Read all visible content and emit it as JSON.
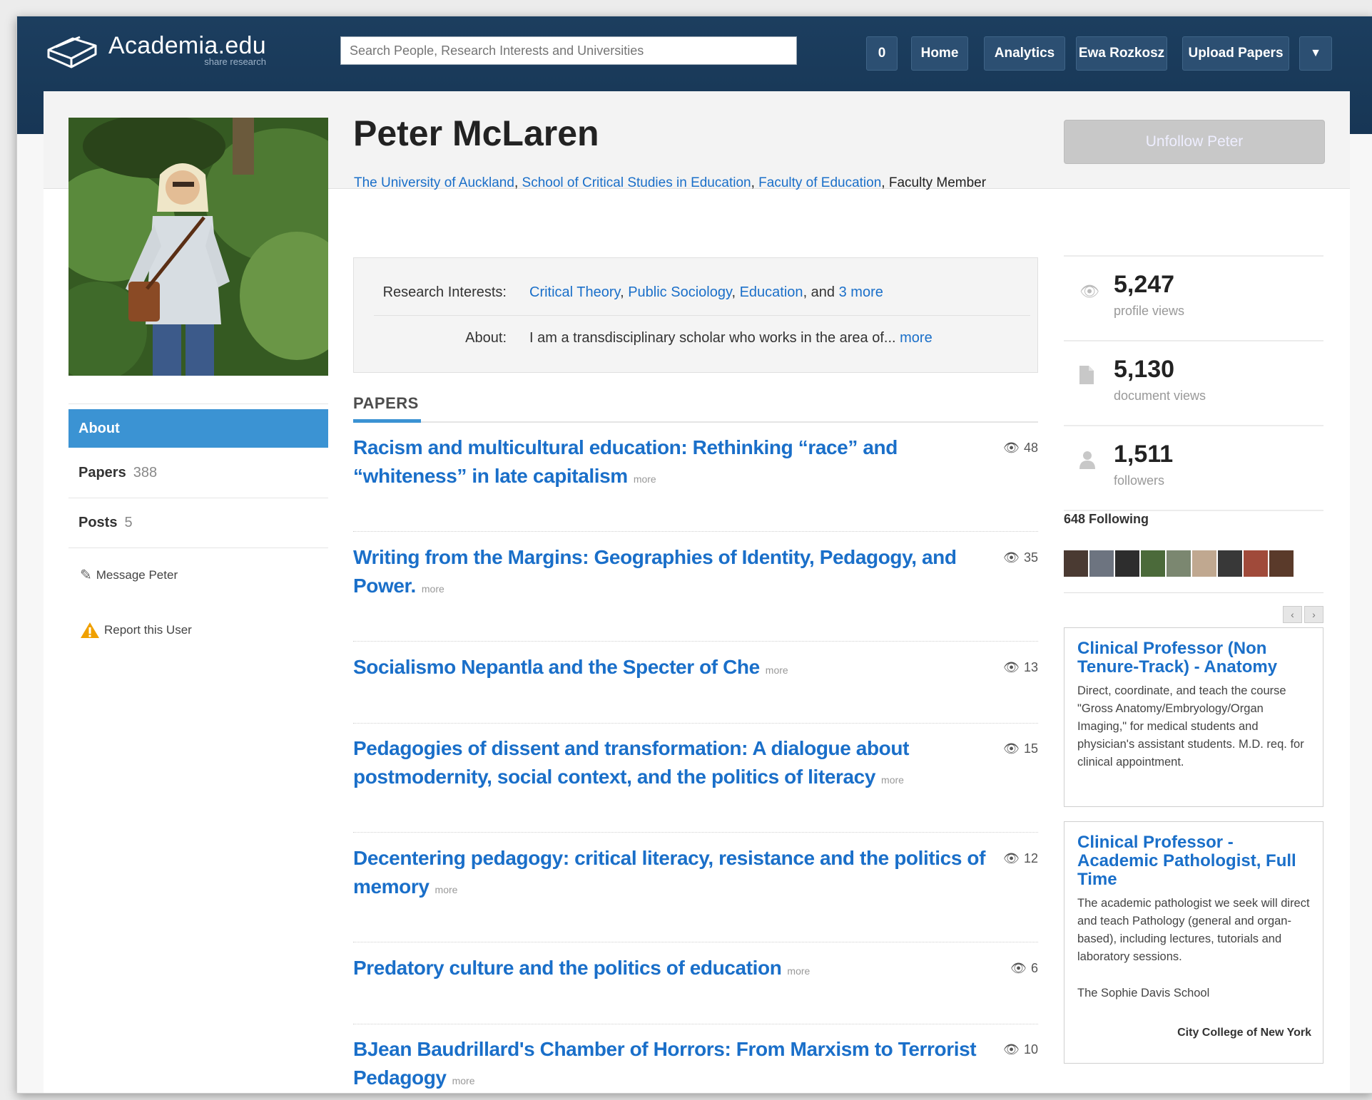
{
  "header": {
    "brand": "Academia.edu",
    "tagline": "share research",
    "search_placeholder": "Search People, Research Interests and Universities",
    "notifications_count": "0",
    "nav": [
      "Home",
      "Analytics",
      "Ewa Rozkosz",
      "Upload Papers"
    ]
  },
  "profile": {
    "name": "Peter McLaren",
    "affiliation_links": [
      "The University of Auckland",
      "School of Critical Studies in Education",
      "Faculty of Education"
    ],
    "role": ", Faculty Member",
    "unfollow_label": "Unfollow Peter"
  },
  "sidebar": {
    "active": "About",
    "items": [
      {
        "label": "Papers",
        "count": "388"
      },
      {
        "label": "Posts",
        "count": "5"
      }
    ],
    "message_label": "Message Peter",
    "report_label": "Report this User"
  },
  "info": {
    "interests_label": "Research Interests:",
    "interests": [
      "Critical Theory",
      "Public Sociology",
      "Education"
    ],
    "interests_and": ", and",
    "interests_more": "3 more",
    "about_label": "About:",
    "about_text": "I am a transdisciplinary scholar who works in the area of...",
    "about_more": "more"
  },
  "papers": {
    "heading": "PAPERS",
    "more_label": "more",
    "items": [
      {
        "title": "Racism and multicultural education: Rethinking “race” and “whiteness” in late capitalism",
        "views": "48"
      },
      {
        "title": "Writing from the Margins: Geographies of Identity, Pedagogy, and Power.",
        "views": "35"
      },
      {
        "title": "Socialismo Nepantla and the Specter of Che",
        "views": "13"
      },
      {
        "title": "Pedagogies of dissent and transformation: A dialogue about postmodernity, social context, and the politics of literacy",
        "views": "15"
      },
      {
        "title": "Decentering pedagogy: critical literacy, resistance and the politics of memory",
        "views": "12"
      },
      {
        "title": "Predatory culture and the politics of education",
        "views": "6"
      },
      {
        "title": "BJean Baudrillard's Chamber of Horrors: From Marxism to Terrorist Pedagogy",
        "views": "10"
      }
    ]
  },
  "stats": [
    {
      "value": "5,247",
      "label": "profile views",
      "icon": "eye-icon"
    },
    {
      "value": "5,130",
      "label": "document views",
      "icon": "document-icon"
    },
    {
      "value": "1,511",
      "label": "followers",
      "icon": "person-icon"
    }
  ],
  "following": {
    "label": "648 Following"
  },
  "ads": [
    {
      "title": "Clinical Professor (Non Tenure-Track) - Anatomy",
      "body": "Direct, coordinate, and teach the course \"Gross Anatomy/Embryology/Organ Imaging,\" for medical students and physician's assistant students. M.D. req. for clinical appointment."
    },
    {
      "title": "Clinical Professor - Academic Pathologist, Full Time",
      "body": "The academic pathologist we seek will direct and teach Pathology (general and organ-based), including lectures, tutorials and laboratory sessions.",
      "school": "The Sophie Davis School",
      "institution": "City College of New York"
    }
  ],
  "colors": {
    "nav_bg": "#1c3e5f",
    "link": "#1a6fc9",
    "active": "#3b93d3"
  }
}
